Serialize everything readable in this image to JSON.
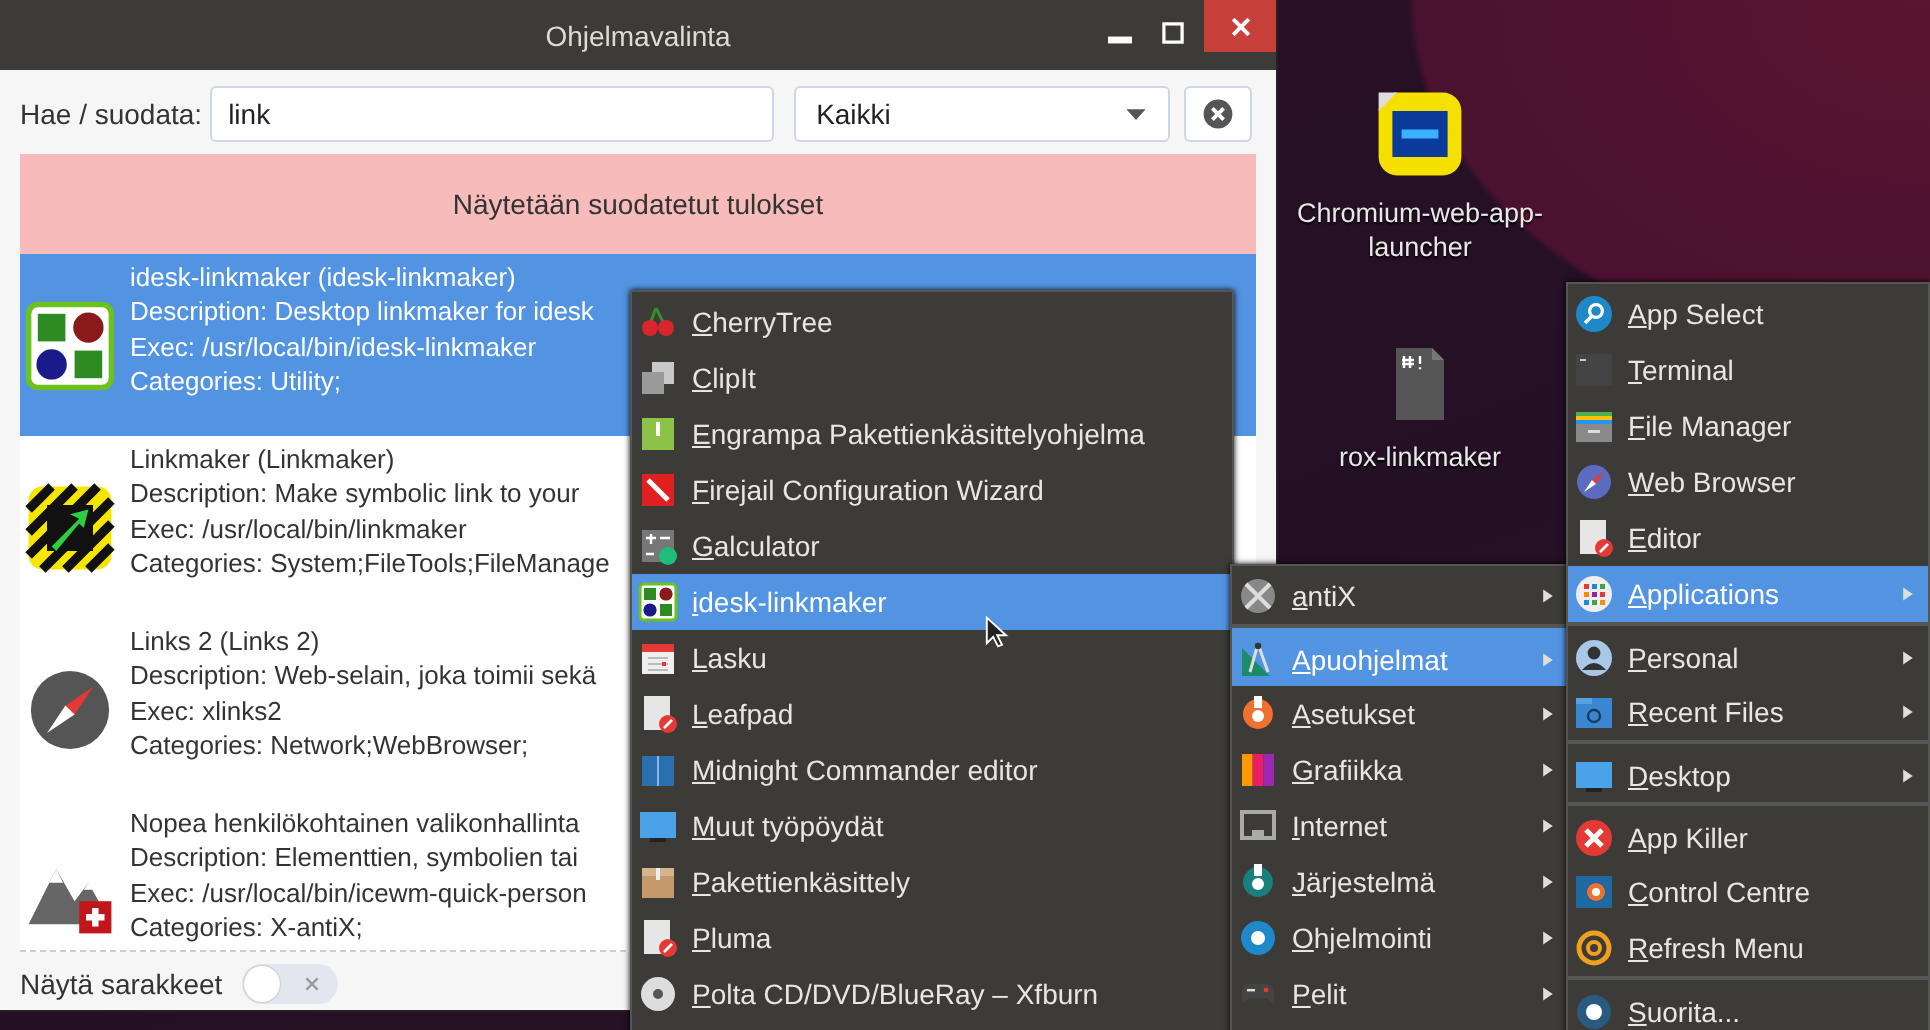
{
  "window": {
    "title": "Ohjelmavalinta",
    "search_label": "Hae / suodata:",
    "search_value": "link",
    "filter_value": "Kaikki",
    "banner": "Näytetään suodatetut tulokset",
    "apps": [
      {
        "name": "idesk-linkmaker (idesk-linkmaker)",
        "description": "Description: Desktop linkmaker for idesk",
        "exec": "Exec: /usr/local/bin/idesk-linkmaker",
        "categories": "Categories: Utility;",
        "selected": true
      },
      {
        "name": "Linkmaker (Linkmaker)",
        "description": "Description: Make symbolic link to your",
        "exec": "Exec: /usr/local/bin/linkmaker",
        "categories": "Categories: System;FileTools;FileManage",
        "selected": false
      },
      {
        "name": "Links 2 (Links 2)",
        "description": "Description: Web-selain, joka toimii sekä",
        "exec": "Exec: xlinks2",
        "categories": "Categories: Network;WebBrowser;",
        "selected": false
      },
      {
        "name": "Nopea henkilökohtainen valikonhallinta",
        "description": "Description: Elementtien, symbolien tai",
        "exec": "Exec: /usr/local/bin/icewm-quick-person",
        "categories": "Categories: X-antiX;",
        "selected": false
      }
    ],
    "toggle_label": "Näytä sarakkeet",
    "toggle_on": false
  },
  "desktop_icons": [
    {
      "label": "Chromium-web-app-launcher"
    },
    {
      "label": "rox-linkmaker"
    }
  ],
  "menus": [
    {
      "items": [
        {
          "label": "CherryTree",
          "selected": false,
          "submenu": false,
          "separator_before": false
        },
        {
          "label": "ClipIt",
          "selected": false,
          "submenu": false,
          "separator_before": false
        },
        {
          "label": "Engrampa Pakettienkäsittelyohjelma",
          "selected": false,
          "submenu": false,
          "separator_before": false
        },
        {
          "label": "Firejail Configuration Wizard",
          "selected": false,
          "submenu": false,
          "separator_before": false
        },
        {
          "label": "Galculator",
          "selected": false,
          "submenu": false,
          "separator_before": false
        },
        {
          "label": "idesk-linkmaker",
          "selected": true,
          "submenu": false,
          "separator_before": false
        },
        {
          "label": "Lasku",
          "selected": false,
          "submenu": false,
          "separator_before": false
        },
        {
          "label": "Leafpad",
          "selected": false,
          "submenu": false,
          "separator_before": false
        },
        {
          "label": "Midnight Commander editor",
          "selected": false,
          "submenu": false,
          "separator_before": false
        },
        {
          "label": "Muut työpöydät",
          "selected": false,
          "submenu": false,
          "separator_before": false
        },
        {
          "label": "Pakettienkäsittely",
          "selected": false,
          "submenu": false,
          "separator_before": false
        },
        {
          "label": "Pluma",
          "selected": false,
          "submenu": false,
          "separator_before": false
        },
        {
          "label": "Polta CD/DVD/BlueRay – Xfburn",
          "selected": false,
          "submenu": false,
          "separator_before": false
        }
      ]
    },
    {
      "items": [
        {
          "label": "antiX",
          "selected": false,
          "submenu": true,
          "separator_before": false
        },
        {
          "label": "Apuohjelmat",
          "selected": true,
          "submenu": true,
          "separator_before": true
        },
        {
          "label": "Asetukset",
          "selected": false,
          "submenu": true,
          "separator_before": false
        },
        {
          "label": "Grafiikka",
          "selected": false,
          "submenu": true,
          "separator_before": false
        },
        {
          "label": "Internet",
          "selected": false,
          "submenu": true,
          "separator_before": false
        },
        {
          "label": "Järjestelmä",
          "selected": false,
          "submenu": true,
          "separator_before": false
        },
        {
          "label": "Ohjelmointi",
          "selected": false,
          "submenu": true,
          "separator_before": false
        },
        {
          "label": "Pelit",
          "selected": false,
          "submenu": true,
          "separator_before": false
        }
      ]
    },
    {
      "items": [
        {
          "label": "App Select",
          "selected": false,
          "submenu": false,
          "separator_before": false
        },
        {
          "label": "Terminal",
          "selected": false,
          "submenu": false,
          "separator_before": false
        },
        {
          "label": "File Manager",
          "selected": false,
          "submenu": false,
          "separator_before": false
        },
        {
          "label": "Web Browser",
          "selected": false,
          "submenu": false,
          "separator_before": false
        },
        {
          "label": "Editor",
          "selected": false,
          "submenu": false,
          "separator_before": false
        },
        {
          "label": "Applications",
          "selected": true,
          "submenu": true,
          "separator_before": false
        },
        {
          "label": "Personal",
          "selected": false,
          "submenu": true,
          "separator_before": true
        },
        {
          "label": "Recent Files",
          "selected": false,
          "submenu": true,
          "separator_before": false
        },
        {
          "label": "Desktop",
          "selected": false,
          "submenu": true,
          "separator_before": true
        },
        {
          "label": "App Killer",
          "selected": false,
          "submenu": false,
          "separator_before": true
        },
        {
          "label": "Control Centre",
          "selected": false,
          "submenu": false,
          "separator_before": false
        },
        {
          "label": "Refresh Menu",
          "selected": false,
          "submenu": false,
          "separator_before": false
        },
        {
          "label": "Suorita...",
          "selected": false,
          "submenu": false,
          "separator_before": true
        }
      ]
    }
  ]
}
